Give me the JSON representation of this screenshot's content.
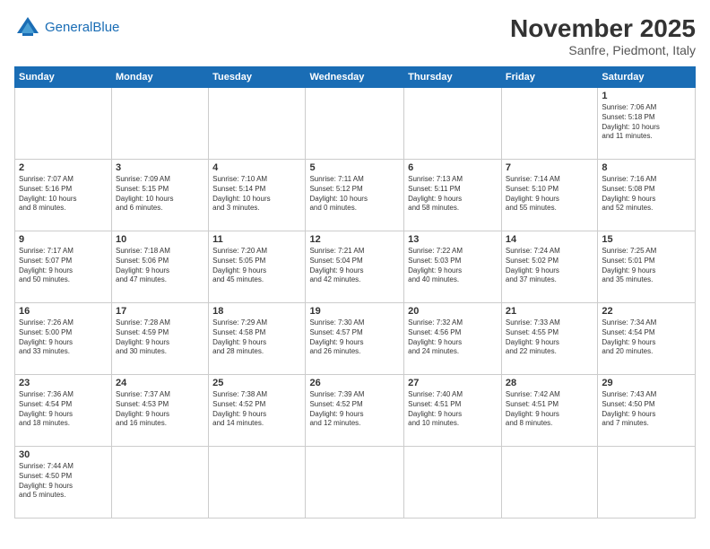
{
  "header": {
    "logo_line1": "General",
    "logo_line2": "Blue",
    "month": "November 2025",
    "location": "Sanfre, Piedmont, Italy"
  },
  "weekdays": [
    "Sunday",
    "Monday",
    "Tuesday",
    "Wednesday",
    "Thursday",
    "Friday",
    "Saturday"
  ],
  "weeks": [
    [
      {
        "day": "",
        "info": ""
      },
      {
        "day": "",
        "info": ""
      },
      {
        "day": "",
        "info": ""
      },
      {
        "day": "",
        "info": ""
      },
      {
        "day": "",
        "info": ""
      },
      {
        "day": "",
        "info": ""
      },
      {
        "day": "1",
        "info": "Sunrise: 7:06 AM\nSunset: 5:18 PM\nDaylight: 10 hours\nand 11 minutes."
      }
    ],
    [
      {
        "day": "2",
        "info": "Sunrise: 7:07 AM\nSunset: 5:16 PM\nDaylight: 10 hours\nand 8 minutes."
      },
      {
        "day": "3",
        "info": "Sunrise: 7:09 AM\nSunset: 5:15 PM\nDaylight: 10 hours\nand 6 minutes."
      },
      {
        "day": "4",
        "info": "Sunrise: 7:10 AM\nSunset: 5:14 PM\nDaylight: 10 hours\nand 3 minutes."
      },
      {
        "day": "5",
        "info": "Sunrise: 7:11 AM\nSunset: 5:12 PM\nDaylight: 10 hours\nand 0 minutes."
      },
      {
        "day": "6",
        "info": "Sunrise: 7:13 AM\nSunset: 5:11 PM\nDaylight: 9 hours\nand 58 minutes."
      },
      {
        "day": "7",
        "info": "Sunrise: 7:14 AM\nSunset: 5:10 PM\nDaylight: 9 hours\nand 55 minutes."
      },
      {
        "day": "8",
        "info": "Sunrise: 7:16 AM\nSunset: 5:08 PM\nDaylight: 9 hours\nand 52 minutes."
      }
    ],
    [
      {
        "day": "9",
        "info": "Sunrise: 7:17 AM\nSunset: 5:07 PM\nDaylight: 9 hours\nand 50 minutes."
      },
      {
        "day": "10",
        "info": "Sunrise: 7:18 AM\nSunset: 5:06 PM\nDaylight: 9 hours\nand 47 minutes."
      },
      {
        "day": "11",
        "info": "Sunrise: 7:20 AM\nSunset: 5:05 PM\nDaylight: 9 hours\nand 45 minutes."
      },
      {
        "day": "12",
        "info": "Sunrise: 7:21 AM\nSunset: 5:04 PM\nDaylight: 9 hours\nand 42 minutes."
      },
      {
        "day": "13",
        "info": "Sunrise: 7:22 AM\nSunset: 5:03 PM\nDaylight: 9 hours\nand 40 minutes."
      },
      {
        "day": "14",
        "info": "Sunrise: 7:24 AM\nSunset: 5:02 PM\nDaylight: 9 hours\nand 37 minutes."
      },
      {
        "day": "15",
        "info": "Sunrise: 7:25 AM\nSunset: 5:01 PM\nDaylight: 9 hours\nand 35 minutes."
      }
    ],
    [
      {
        "day": "16",
        "info": "Sunrise: 7:26 AM\nSunset: 5:00 PM\nDaylight: 9 hours\nand 33 minutes."
      },
      {
        "day": "17",
        "info": "Sunrise: 7:28 AM\nSunset: 4:59 PM\nDaylight: 9 hours\nand 30 minutes."
      },
      {
        "day": "18",
        "info": "Sunrise: 7:29 AM\nSunset: 4:58 PM\nDaylight: 9 hours\nand 28 minutes."
      },
      {
        "day": "19",
        "info": "Sunrise: 7:30 AM\nSunset: 4:57 PM\nDaylight: 9 hours\nand 26 minutes."
      },
      {
        "day": "20",
        "info": "Sunrise: 7:32 AM\nSunset: 4:56 PM\nDaylight: 9 hours\nand 24 minutes."
      },
      {
        "day": "21",
        "info": "Sunrise: 7:33 AM\nSunset: 4:55 PM\nDaylight: 9 hours\nand 22 minutes."
      },
      {
        "day": "22",
        "info": "Sunrise: 7:34 AM\nSunset: 4:54 PM\nDaylight: 9 hours\nand 20 minutes."
      }
    ],
    [
      {
        "day": "23",
        "info": "Sunrise: 7:36 AM\nSunset: 4:54 PM\nDaylight: 9 hours\nand 18 minutes."
      },
      {
        "day": "24",
        "info": "Sunrise: 7:37 AM\nSunset: 4:53 PM\nDaylight: 9 hours\nand 16 minutes."
      },
      {
        "day": "25",
        "info": "Sunrise: 7:38 AM\nSunset: 4:52 PM\nDaylight: 9 hours\nand 14 minutes."
      },
      {
        "day": "26",
        "info": "Sunrise: 7:39 AM\nSunset: 4:52 PM\nDaylight: 9 hours\nand 12 minutes."
      },
      {
        "day": "27",
        "info": "Sunrise: 7:40 AM\nSunset: 4:51 PM\nDaylight: 9 hours\nand 10 minutes."
      },
      {
        "day": "28",
        "info": "Sunrise: 7:42 AM\nSunset: 4:51 PM\nDaylight: 9 hours\nand 8 minutes."
      },
      {
        "day": "29",
        "info": "Sunrise: 7:43 AM\nSunset: 4:50 PM\nDaylight: 9 hours\nand 7 minutes."
      }
    ],
    [
      {
        "day": "30",
        "info": "Sunrise: 7:44 AM\nSunset: 4:50 PM\nDaylight: 9 hours\nand 5 minutes."
      },
      {
        "day": "",
        "info": ""
      },
      {
        "day": "",
        "info": ""
      },
      {
        "day": "",
        "info": ""
      },
      {
        "day": "",
        "info": ""
      },
      {
        "day": "",
        "info": ""
      },
      {
        "day": "",
        "info": ""
      }
    ]
  ]
}
